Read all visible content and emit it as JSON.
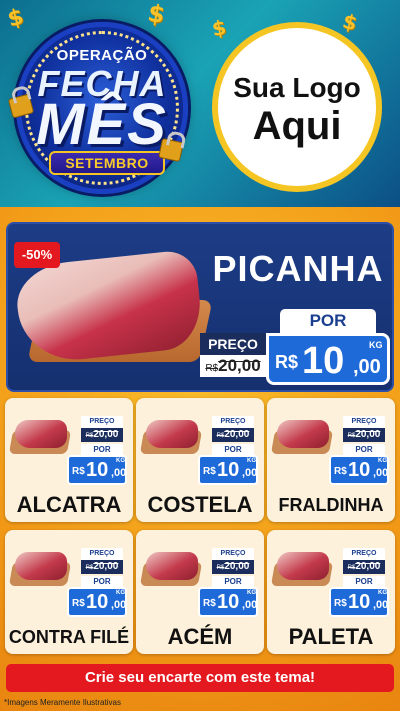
{
  "header": {
    "badge": {
      "line1": "OPERAÇÃO",
      "line2": "FECHA",
      "line3": "MÊS",
      "month": "SETEMBRO"
    },
    "logo": {
      "line1": "Sua Logo",
      "line2": "Aqui"
    },
    "decor_symbol": "$"
  },
  "hero": {
    "discount": "-50%",
    "name": "PICANHA",
    "preco_label": "PREÇO",
    "old_currency": "R$",
    "old_price": "20,00",
    "por_label": "POR",
    "currency": "R$",
    "price_int": "10",
    "price_dec": ",00",
    "unit": "KG"
  },
  "products": [
    {
      "name": "ALCATRA",
      "preco_label": "PREÇO",
      "old_currency": "R$",
      "old_price": "20,00",
      "por_label": "POR",
      "currency": "R$",
      "price_int": "10",
      "price_dec": ",00",
      "unit": "KG"
    },
    {
      "name": "COSTELA",
      "preco_label": "PREÇO",
      "old_currency": "R$",
      "old_price": "20,00",
      "por_label": "POR",
      "currency": "R$",
      "price_int": "10",
      "price_dec": ",00",
      "unit": "KG"
    },
    {
      "name": "FRALDINHA",
      "preco_label": "PREÇO",
      "old_currency": "R$",
      "old_price": "20,00",
      "por_label": "POR",
      "currency": "R$",
      "price_int": "10",
      "price_dec": ",00",
      "unit": "KG"
    },
    {
      "name": "CONTRA FILÉ",
      "preco_label": "PREÇO",
      "old_currency": "R$",
      "old_price": "20,00",
      "por_label": "POR",
      "currency": "R$",
      "price_int": "10",
      "price_dec": ",00",
      "unit": "KG"
    },
    {
      "name": "ACÉM",
      "preco_label": "PREÇO",
      "old_currency": "R$",
      "old_price": "20,00",
      "por_label": "POR",
      "currency": "R$",
      "price_int": "10",
      "price_dec": ",00",
      "unit": "KG"
    },
    {
      "name": "PALETA",
      "preco_label": "PREÇO",
      "old_currency": "R$",
      "old_price": "20,00",
      "por_label": "POR",
      "currency": "R$",
      "price_int": "10",
      "price_dec": ",00",
      "unit": "KG"
    }
  ],
  "footer": {
    "cta": "Crie seu encarte com este tema!",
    "disclaimer": "*Imagens Meramente Ilustrativas"
  },
  "colors": {
    "header_teal": "#1aa3b5",
    "orange_bg": "#f3a51a",
    "hero_navy": "#1c3c86",
    "price_blue": "#1f6ad9",
    "cta_red": "#e3191f",
    "gold": "#f5c623"
  }
}
